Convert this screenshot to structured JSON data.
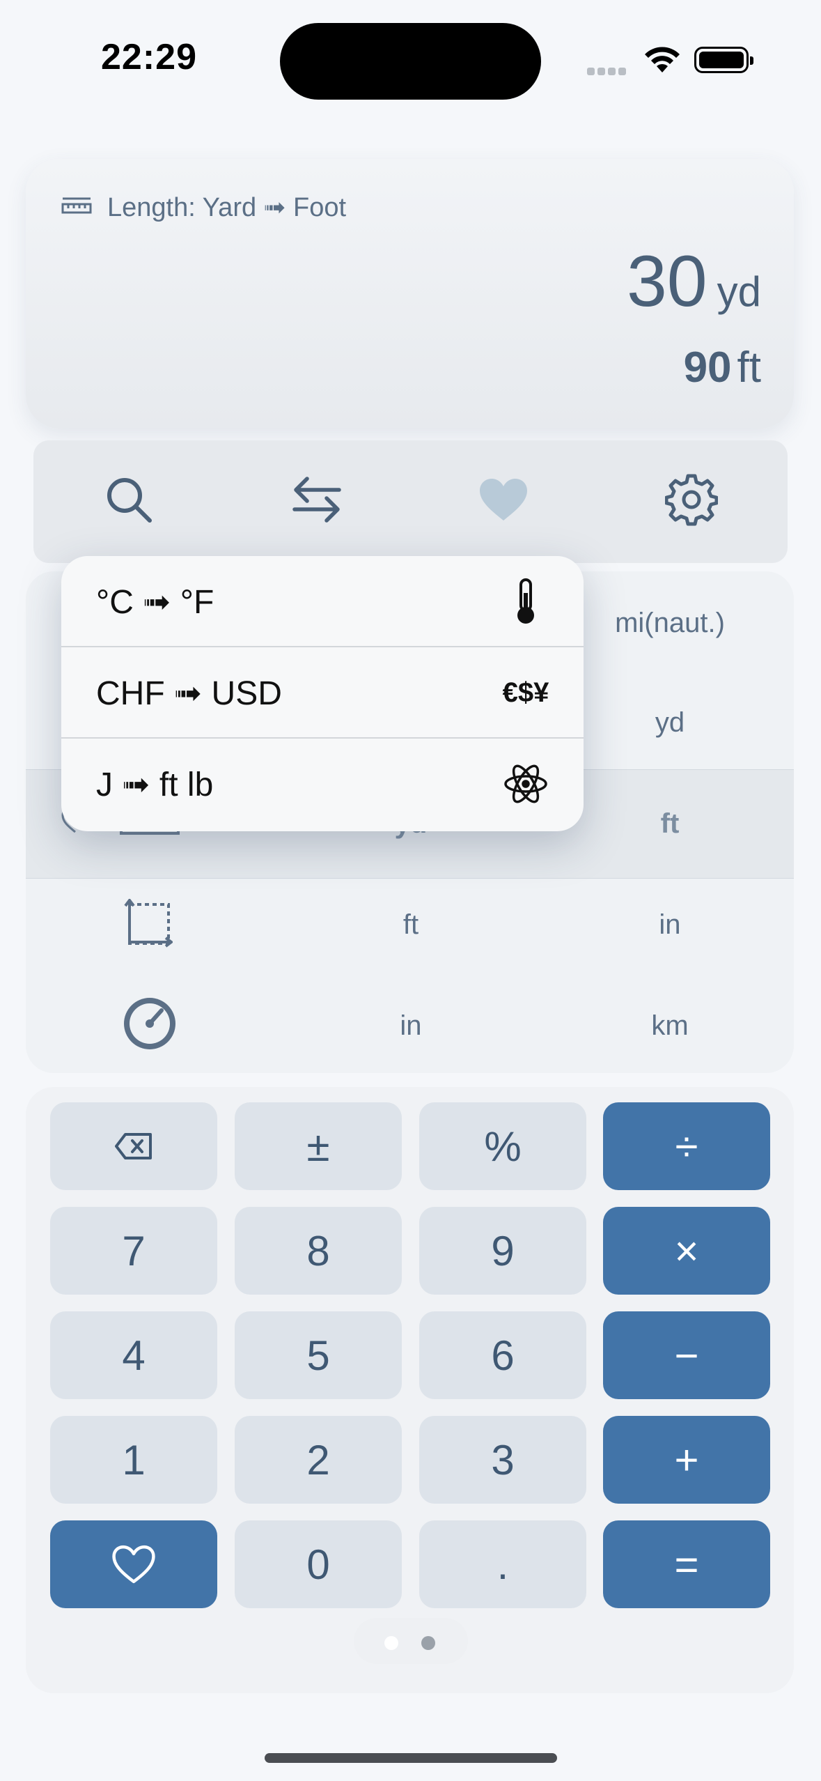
{
  "status_bar": {
    "time": "22:29"
  },
  "display": {
    "conversion_title": "Length: Yard ➟ Foot",
    "input_value": "30",
    "input_unit": "yd",
    "output_value": "90",
    "output_unit": "ft"
  },
  "toolbar": {
    "items": [
      "search-icon",
      "swap-icon",
      "heart-icon",
      "gear-icon"
    ]
  },
  "unit_list": {
    "rows": [
      {
        "icon": "",
        "from": "",
        "to": "mi(naut.)"
      },
      {
        "icon": "",
        "from": "",
        "to": "yd"
      },
      {
        "icon": "ruler-icon",
        "from": "yd",
        "to": "ft",
        "selected": true
      },
      {
        "icon": "area-icon",
        "from": "ft",
        "to": "in"
      },
      {
        "icon": "speedometer-icon",
        "from": "in",
        "to": "km"
      }
    ]
  },
  "menu": {
    "items": [
      {
        "label": "°C ➟ °F",
        "icon": "thermometer-icon"
      },
      {
        "label": "CHF ➟ USD",
        "icon_text": "€$¥"
      },
      {
        "label": "J ➟ ft lb",
        "icon": "atom-icon"
      }
    ]
  },
  "keypad": {
    "rows": [
      [
        "⌫",
        "±",
        "%",
        "÷"
      ],
      [
        "7",
        "8",
        "9",
        "×"
      ],
      [
        "4",
        "5",
        "6",
        "−"
      ],
      [
        "1",
        "2",
        "3",
        "+"
      ],
      [
        "♡",
        "0",
        ".",
        "="
      ]
    ]
  },
  "page_indicator": {
    "pages": 2,
    "current": 1
  },
  "colors": {
    "accent": "#4274a8",
    "key": "#dde3ea",
    "text": "#4a6078"
  }
}
